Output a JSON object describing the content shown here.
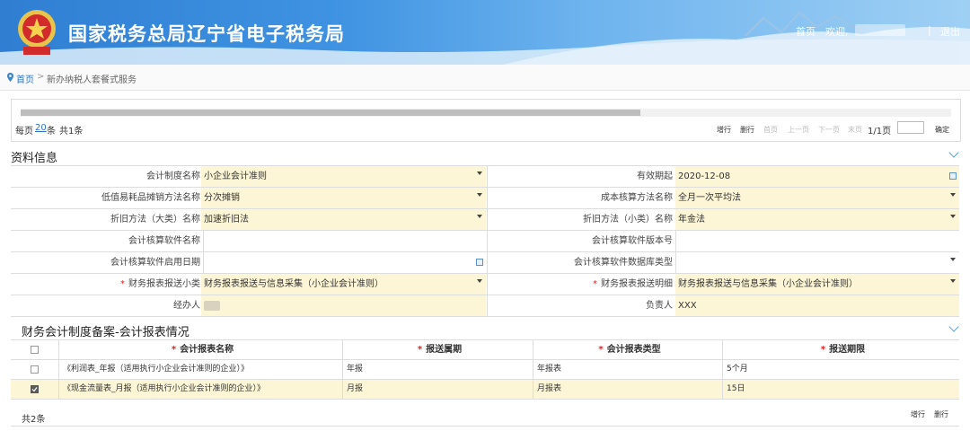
{
  "header": {
    "title": "国家税务总局辽宁省电子税务局",
    "home": "首页",
    "welcome": "欢迎,",
    "separator": "|",
    "logout": "退出"
  },
  "breadcrumb": {
    "home": "首页",
    "sep": ">",
    "current": "新办纳税人套餐式服务"
  },
  "pager": {
    "per_page_prefix": "每页",
    "per_page_count": "20",
    "per_page_suffix": "条",
    "total": "共1条",
    "buttons": [
      "增行",
      "删行",
      "首页",
      "上一页",
      "下一页",
      "末页"
    ],
    "page_info": "1/1页",
    "confirm": "确定"
  },
  "profile": {
    "title": "资料信息",
    "labels": {
      "acct_system": "会计制度名称",
      "valid_from": "有效期起",
      "low_value": "低值易耗品摊销方法名称",
      "cost_method": "成本核算方法名称",
      "depr_major": "折旧方法（大类）名称",
      "depr_minor": "折旧方法（小类）名称",
      "sw_name": "会计核算软件名称",
      "sw_version": "会计核算软件版本号",
      "sw_start": "会计核算软件启用日期",
      "sw_db": "会计核算软件数据库类型",
      "report_small": "财务报表报送小类",
      "report_detail": "财务报表报送明细",
      "handler": "经办人",
      "owner": "负责人"
    },
    "values": {
      "acct_system": "小企业会计准则",
      "valid_from": "2020-12-08",
      "low_value": "分次摊销",
      "cost_method": "全月一次平均法",
      "depr_major": "加速折旧法",
      "depr_minor": "年金法",
      "report_small": "财务报表报送与信息采集（小企业会计准则）",
      "report_detail": "财务报表报送与信息采集（小企业会计准则）",
      "owner": "XXX"
    }
  },
  "reports": {
    "title": "财务会计制度备案-会计报表情况",
    "columns": [
      "会计报表名称",
      "报送属期",
      "会计报表类型",
      "报送期限"
    ],
    "rows": [
      {
        "checked": false,
        "cells": [
          "《利润表_年报（适用执行小企业会计准则的企业）》",
          "年报",
          "年报表",
          "5个月"
        ]
      },
      {
        "checked": true,
        "cells": [
          "《现金流量表_月报（适用执行小企业会计准则的企业）》",
          "月报",
          "月报表",
          "15日"
        ]
      }
    ],
    "total": "共2条",
    "add_row": "增行",
    "delete_row": "删行"
  },
  "colors": {
    "banner": "#3f93e2",
    "required": "#e02020",
    "field_bg": "#fdf6d6"
  }
}
